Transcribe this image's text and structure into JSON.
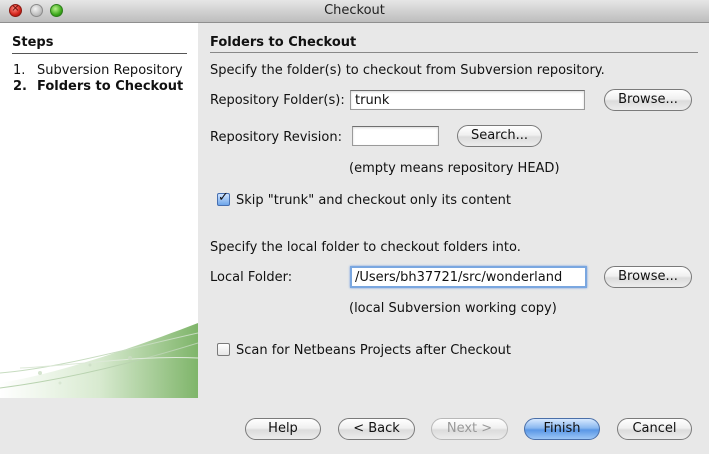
{
  "window": {
    "title": "Checkout"
  },
  "steps": {
    "heading": "Steps",
    "items": [
      {
        "number": "1.",
        "label": "Subversion Repository"
      },
      {
        "number": "2.",
        "label": "Folders to Checkout"
      }
    ]
  },
  "panel": {
    "heading": "Folders to Checkout",
    "intro": "Specify the folder(s) to checkout from Subversion repository.",
    "repo_folder": {
      "label": "Repository Folder(s):",
      "value": "trunk",
      "browse": "Browse..."
    },
    "repo_revision": {
      "label": "Repository Revision:",
      "value": "",
      "search": "Search...",
      "hint": "(empty means repository HEAD)"
    },
    "skip_trunk": {
      "label": "Skip \"trunk\" and checkout only its content",
      "checked": true
    },
    "local_intro": "Specify the local folder to checkout folders into.",
    "local_folder": {
      "label": "Local Folder:",
      "value": "/Users/bh37721/src/wonderland",
      "browse": "Browse...",
      "hint": "(local Subversion working copy)"
    },
    "scan_netbeans": {
      "label": "Scan for Netbeans Projects after Checkout",
      "checked": false
    }
  },
  "footer": {
    "help": "Help",
    "back": "< Back",
    "next": "Next >",
    "finish": "Finish",
    "cancel": "Cancel"
  }
}
